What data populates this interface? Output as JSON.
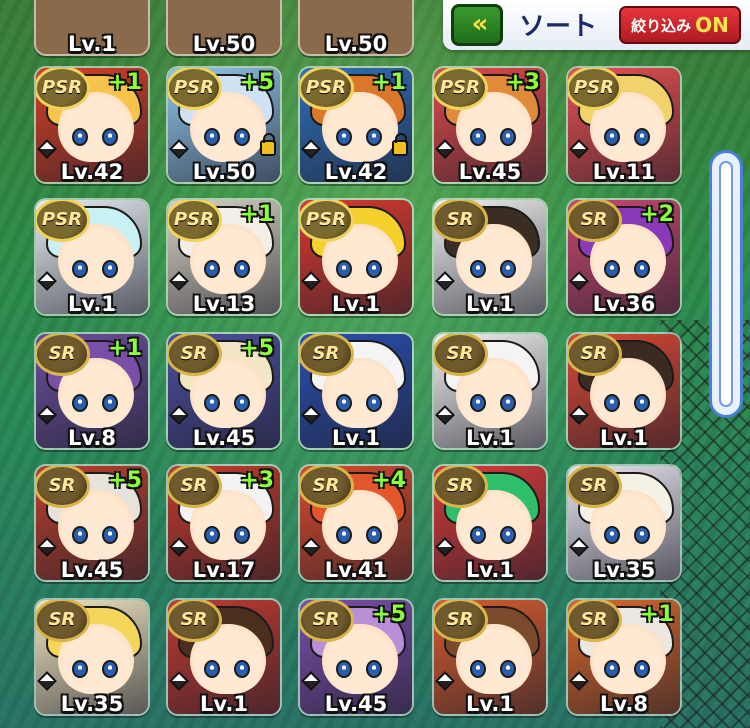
{
  "header": {
    "back_icon_glyph": "«",
    "sort_label": "ソート",
    "filter_label": "絞り込み",
    "filter_state": "ON"
  },
  "partial_row": [
    {
      "level": "Lv.1"
    },
    {
      "level": "Lv.50"
    },
    {
      "level": "Lv.50"
    }
  ],
  "cards": [
    {
      "rarity": "PSR",
      "plus": "+1",
      "level": "Lv.42",
      "locked": false,
      "hair": "#f7c34a",
      "bg": "#d64026"
    },
    {
      "rarity": "PSR",
      "plus": "+5",
      "level": "Lv.50",
      "locked": true,
      "hair": "#cfe2f3",
      "bg": "#8fc4e9"
    },
    {
      "rarity": "PSR",
      "plus": "+1",
      "level": "Lv.42",
      "locked": true,
      "hair": "#d9772b",
      "bg": "#2f6fb8"
    },
    {
      "rarity": "PSR",
      "plus": "+3",
      "level": "Lv.45",
      "locked": false,
      "hair": "#e08a3a",
      "bg": "#e04a4a"
    },
    {
      "rarity": "PSR",
      "plus": "",
      "level": "Lv.11",
      "locked": false,
      "hair": "#f2d26a",
      "bg": "#e85050"
    },
    {
      "rarity": "PSR",
      "plus": "",
      "level": "Lv.1",
      "locked": false,
      "hair": "#c9f0f3",
      "bg": "#e6eef2"
    },
    {
      "rarity": "PSR",
      "plus": "+1",
      "level": "Lv.13",
      "locked": false,
      "hair": "#f3efe6",
      "bg": "#d8d2c4"
    },
    {
      "rarity": "PSR",
      "plus": "",
      "level": "Lv.1",
      "locked": false,
      "hair": "#f4d12a",
      "bg": "#d93a2e"
    },
    {
      "rarity": "SR",
      "plus": "",
      "level": "Lv.1",
      "locked": false,
      "hair": "#3b2c24",
      "bg": "#f0f0f0"
    },
    {
      "rarity": "SR",
      "plus": "+2",
      "level": "Lv.36",
      "locked": false,
      "hair": "#8a3ab8",
      "bg": "#c7486f"
    },
    {
      "rarity": "SR",
      "plus": "+1",
      "level": "Lv.8",
      "locked": false,
      "hair": "#7a4fa8",
      "bg": "#6a4f9a"
    },
    {
      "rarity": "SR",
      "plus": "+5",
      "level": "Lv.45",
      "locked": false,
      "hair": "#f3e6c4",
      "bg": "#4b4f9d"
    },
    {
      "rarity": "SR",
      "plus": "",
      "level": "Lv.1",
      "locked": false,
      "hair": "#f4f4f4",
      "bg": "#2a4fae"
    },
    {
      "rarity": "SR",
      "plus": "",
      "level": "Lv.1",
      "locked": false,
      "hair": "#f4f4f4",
      "bg": "#f2f2f2"
    },
    {
      "rarity": "SR",
      "plus": "",
      "level": "Lv.1",
      "locked": false,
      "hair": "#3a2a22",
      "bg": "#d94834"
    },
    {
      "rarity": "SR",
      "plus": "+5",
      "level": "Lv.45",
      "locked": false,
      "hair": "#e8e2dd",
      "bg": "#b8402e"
    },
    {
      "rarity": "SR",
      "plus": "+3",
      "level": "Lv.17",
      "locked": false,
      "hair": "#f3f3f3",
      "bg": "#c23b2b"
    },
    {
      "rarity": "SR",
      "plus": "+4",
      "level": "Lv.41",
      "locked": false,
      "hair": "#e2562a",
      "bg": "#d84a2c"
    },
    {
      "rarity": "SR",
      "plus": "",
      "level": "Lv.1",
      "locked": false,
      "hair": "#2fbf6a",
      "bg": "#d63a3a"
    },
    {
      "rarity": "SR",
      "plus": "",
      "level": "Lv.35",
      "locked": false,
      "hair": "#f6f1e6",
      "bg": "#e8e6f0"
    },
    {
      "rarity": "SR",
      "plus": "",
      "level": "Lv.35",
      "locked": false,
      "hair": "#f4d75a",
      "bg": "#f0e6c0"
    },
    {
      "rarity": "SR",
      "plus": "",
      "level": "Lv.1",
      "locked": false,
      "hair": "#4a2e1e",
      "bg": "#c13a30"
    },
    {
      "rarity": "SR",
      "plus": "+5",
      "level": "Lv.45",
      "locked": false,
      "hair": "#b98fd8",
      "bg": "#7a4fa8"
    },
    {
      "rarity": "SR",
      "plus": "",
      "level": "Lv.1",
      "locked": false,
      "hair": "#7a4a2a",
      "bg": "#d65c2e"
    },
    {
      "rarity": "SR",
      "plus": "+1",
      "level": "Lv.8",
      "locked": false,
      "hair": "#ede7e2",
      "bg": "#d9682a"
    }
  ],
  "scrollbar": {
    "position_fraction": 0.0
  }
}
